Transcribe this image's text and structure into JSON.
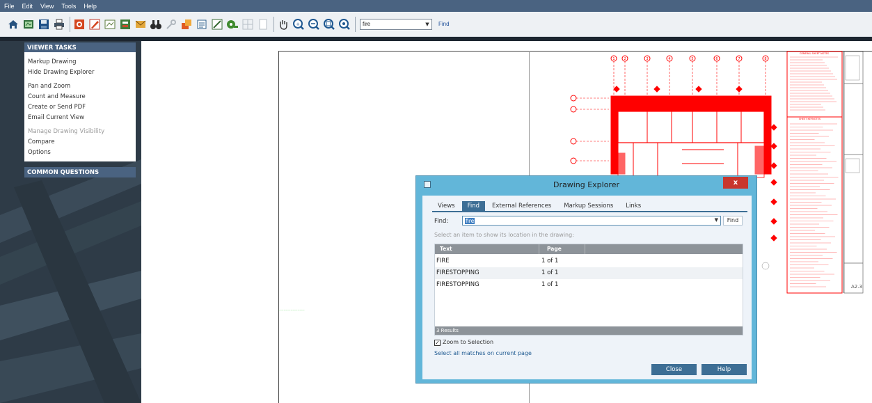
{
  "menu": [
    "File",
    "Edit",
    "View",
    "Tools",
    "Help"
  ],
  "toolbar": {
    "icons_group1": [
      "home-icon",
      "open-drawing-icon",
      "save-icon",
      "print-icon",
      "markup-icon",
      "edit-markup-icon",
      "stamp-icon",
      "publish-icon",
      "email-icon",
      "binoculars-icon",
      "key-icon",
      "layers-icon",
      "compare-icon",
      "measure-icon",
      "tape-measure-icon",
      "grid-icon",
      "page-icon"
    ],
    "icons_group2": [
      "pan-hand-icon",
      "zoom-in-icon",
      "zoom-out-icon",
      "zoom-fit-icon",
      "zoom-window-icon"
    ],
    "search_value": "fire",
    "find_label": "Find"
  },
  "viewer_tasks": {
    "header": "VIEWER TASKS",
    "items": [
      {
        "label": "Markup Drawing",
        "enabled": true
      },
      {
        "label": "Hide Drawing Explorer",
        "enabled": true
      },
      {
        "label": "Pan and Zoom",
        "enabled": true
      },
      {
        "label": "Count and Measure",
        "enabled": true
      },
      {
        "label": "Create or Send PDF",
        "enabled": true
      },
      {
        "label": "Email Current View",
        "enabled": true
      },
      {
        "label": "Manage Drawing Visibility",
        "enabled": false
      },
      {
        "label": "Compare",
        "enabled": true
      },
      {
        "label": "Options",
        "enabled": true
      }
    ]
  },
  "common_questions": {
    "header": "COMMON QUESTIONS"
  },
  "drawing": {
    "accent_color": "#ff0000",
    "green_note_color": "#19c719",
    "sheet_number": "A2.3",
    "grid_labels_top": [
      "1",
      "2",
      "3",
      "4",
      "5",
      "6",
      "7",
      "8"
    ],
    "notes_heading_1": "GENERAL SHEET NOTES",
    "notes_heading_2": "SHEET KEYNOTES"
  },
  "dialog": {
    "title": "Drawing Explorer",
    "close_glyph": "x",
    "tabs": [
      "Views",
      "Find",
      "External References",
      "Markup Sessions",
      "Links"
    ],
    "active_tab": "Find",
    "find_label": "Find:",
    "find_value": "fire",
    "find_button": "Find",
    "hint": "Select an item to show its location in the drawing:",
    "columns": [
      "Text",
      "Page"
    ],
    "rows": [
      {
        "text": "FIRE",
        "page": "1 of 1"
      },
      {
        "text": "FIRESTOPPING",
        "page": "1 of 1"
      },
      {
        "text": "FIRESTOPPING",
        "page": "1 of 1"
      }
    ],
    "results_count": "3 Results",
    "zoom_checkbox_label": "Zoom to Selection",
    "zoom_checked": true,
    "select_all_link": "Select all matches on current page",
    "close_button": "Close",
    "help_button": "Help"
  },
  "colors": {
    "menubar": "#4a6381",
    "panel_header": "#4a6381",
    "left_panel_bg": "#2e3b47",
    "dialog_frame": "#62b6d9",
    "dialog_button": "#3d6e95",
    "close_red": "#c8362d"
  }
}
